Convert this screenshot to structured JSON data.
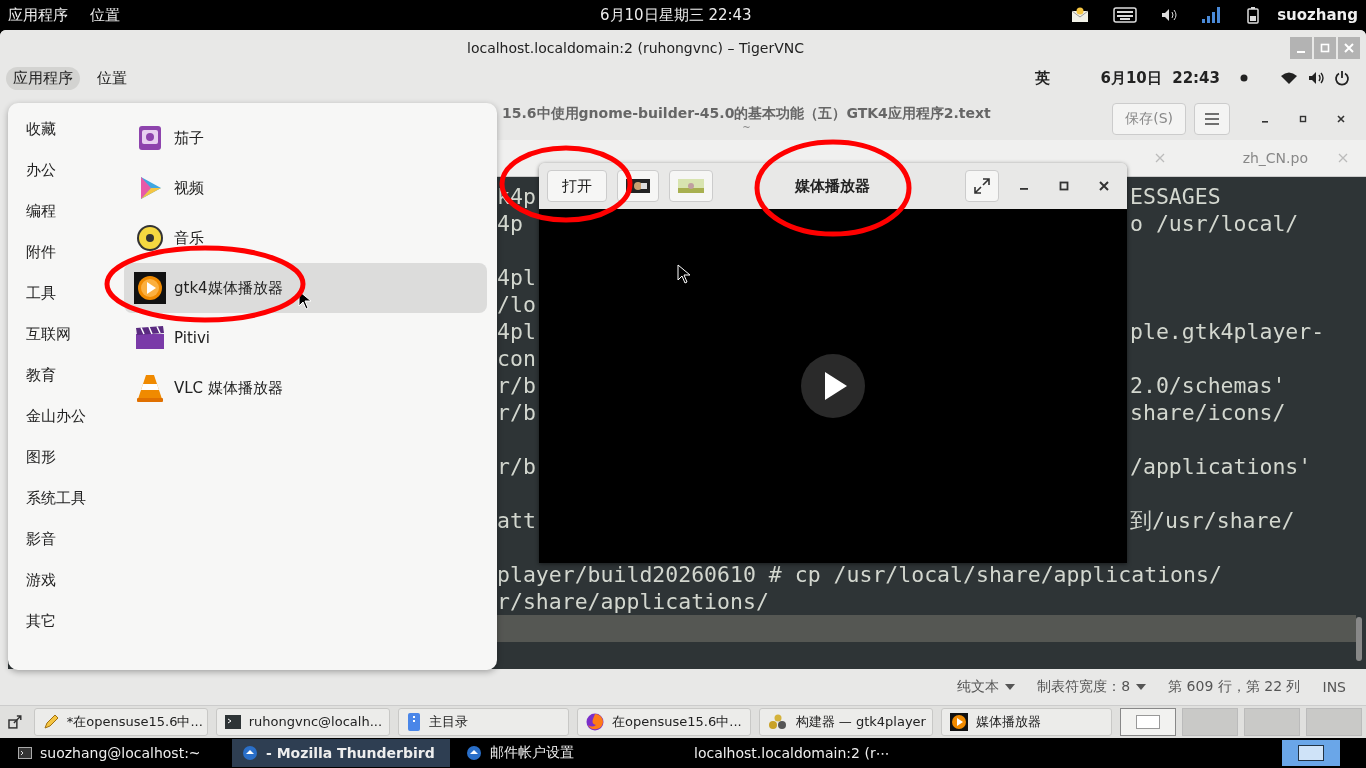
{
  "top_bar": {
    "menus": [
      "应用程序",
      "位置"
    ],
    "clock": "6月10日星期三 22:43",
    "user": "suozhang"
  },
  "vnc_window": {
    "title": "localhost.localdomain:2 (ruhongvnc) – TigerVNC"
  },
  "remote_top_bar": {
    "menus": [
      {
        "label": "应用程序",
        "selected": true
      },
      {
        "label": "位置",
        "selected": false
      }
    ],
    "input_method": "英",
    "clock": "6月10日  22:43"
  },
  "editor": {
    "title": "15.6中使用gnome-builder-45.0的基本功能（五）GTK4应用程序2.text",
    "subtitle": "~",
    "save_button": "保存(S)",
    "tabs": [
      {
        "label": "zh_CN.po"
      }
    ],
    "lines": [
      {
        "kind": "split",
        "left": "k4p",
        "right": "ESSAGES",
        "current": false
      },
      {
        "kind": "split",
        "left": "4p",
        "right": "o /usr/local/",
        "current": false
      },
      {
        "kind": "blank",
        "current": false
      },
      {
        "kind": "split",
        "left": "4pl",
        "current": false
      },
      {
        "kind": "split",
        "left": "/lo",
        "current": false
      },
      {
        "kind": "split",
        "left": "4pl",
        "right": "ple.gtk4player-",
        "current": false
      },
      {
        "kind": "split",
        "left": "con",
        "current": false
      },
      {
        "kind": "split",
        "left": "r/b",
        "right": "2.0/schemas'",
        "current": false
      },
      {
        "kind": "split",
        "left": "r/b",
        "right": "share/icons/",
        "current": false
      },
      {
        "kind": "blank",
        "current": false
      },
      {
        "kind": "split",
        "left": "r/b",
        "right": "/applications'",
        "current": false
      },
      {
        "kind": "blank",
        "current": false
      },
      {
        "kind": "split",
        "left": "att",
        "right": "到/usr/share/",
        "current": false
      },
      {
        "kind": "blank",
        "current": false
      },
      {
        "kind": "full",
        "text": "player/build20260610 # cp /usr/local/share/applications/",
        "current": false
      },
      {
        "kind": "full",
        "text": "r/share/applications/",
        "current": false
      },
      {
        "kind": "blank",
        "current": true
      },
      {
        "kind": "blank",
        "current": false
      }
    ],
    "status": {
      "language": "纯文本",
      "tab_width": "制表符宽度：8",
      "position": "第 609 行，第 22 列",
      "mode": "INS"
    }
  },
  "app_menu": {
    "categories": [
      "收藏",
      "办公",
      "编程",
      "附件",
      "工具",
      "互联网",
      "教育",
      "金山办公",
      "图形",
      "系统工具",
      "影音",
      "游戏",
      "其它"
    ],
    "apps": [
      {
        "name": "茄子",
        "selected": false
      },
      {
        "name": "视频",
        "selected": false
      },
      {
        "name": "音乐",
        "selected": false
      },
      {
        "name": "gtk4媒体播放器",
        "selected": true
      },
      {
        "name": "Pitivi",
        "selected": false
      },
      {
        "name": "VLC 媒体播放器",
        "selected": false
      }
    ]
  },
  "media_player": {
    "title": "媒体播放器",
    "open_button": "打开"
  },
  "remote_taskbar": {
    "items": [
      {
        "label": "*在opensuse15.6中...",
        "selected": false
      },
      {
        "label": "ruhongvnc@localh...",
        "selected": false
      },
      {
        "label": "主目录",
        "selected": false
      },
      {
        "label": "在opensuse15.6中...",
        "selected": false
      },
      {
        "label": "构建器 — gtk4player",
        "selected": false
      },
      {
        "label": "媒体播放器",
        "selected": false
      }
    ],
    "workspaces": [
      {
        "selected": true
      },
      {
        "selected": false
      },
      {
        "selected": false
      },
      {
        "selected": false
      }
    ]
  },
  "host_taskbar": {
    "items": [
      {
        "label": "suozhang@localhost:~",
        "selected": false
      },
      {
        "label": "- Mozilla Thunderbird",
        "selected": true
      },
      {
        "label": "邮件帐户设置",
        "selected": false
      },
      {
        "label": "localhost.localdomain:2 (r⋯",
        "selected": false
      }
    ]
  }
}
